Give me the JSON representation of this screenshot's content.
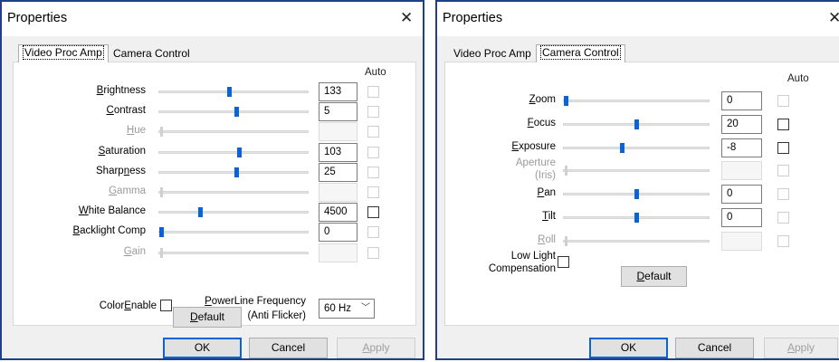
{
  "dialogs": [
    {
      "title": "Properties",
      "close_glyph": "✕",
      "tabs": [
        "Video Proc Amp",
        "Camera Control"
      ],
      "active_tab": 0,
      "auto_header": "Auto",
      "controls": [
        {
          "label": "Brightness",
          "value": "133",
          "slider": 0.45,
          "enabled": true,
          "auto_checked": false
        },
        {
          "label": "Contrast",
          "value": "5",
          "slider": 0.5,
          "enabled": true,
          "auto_checked": false
        },
        {
          "label": "Hue",
          "value": "",
          "slider": 0.0,
          "enabled": false,
          "auto_checked": false
        },
        {
          "label": "Saturation",
          "value": "103",
          "slider": 0.52,
          "enabled": true,
          "auto_checked": false
        },
        {
          "label": "Sharpness",
          "value": "25",
          "slider": 0.5,
          "enabled": true,
          "auto_checked": false
        },
        {
          "label": "Gamma",
          "value": "",
          "slider": 0.0,
          "enabled": false,
          "auto_checked": false
        },
        {
          "label": "White Balance",
          "value": "4500",
          "slider": 0.26,
          "enabled": true,
          "auto_checked": false
        },
        {
          "label": "Backlight Comp",
          "value": "0",
          "slider": 0.0,
          "enabled": true,
          "auto_checked": false
        },
        {
          "label": "Gain",
          "value": "",
          "slider": 0.0,
          "enabled": false,
          "auto_checked": false
        }
      ],
      "color_enable_label": "ColorEnable",
      "powerline_label_1": "PowerLine Frequency",
      "powerline_label_2": "(Anti Flicker)",
      "powerline_value": "60 Hz",
      "default_button": "Default",
      "ok_button": "OK",
      "cancel_button": "Cancel",
      "apply_button": "Apply"
    },
    {
      "title": "Properties",
      "close_glyph": "✕",
      "tabs": [
        "Video Proc Amp",
        "Camera Control"
      ],
      "active_tab": 1,
      "auto_header": "Auto",
      "controls": [
        {
          "label": "Zoom",
          "value": "0",
          "slider": 0.0,
          "enabled": true,
          "auto_checked": false
        },
        {
          "label": "Focus",
          "value": "20",
          "slider": 0.48,
          "enabled": true,
          "auto_checked": false
        },
        {
          "label": "Exposure",
          "value": "-8",
          "slider": 0.38,
          "enabled": true,
          "auto_checked": false
        },
        {
          "label": "Aperture",
          "label2": "(Iris)",
          "value": "",
          "slider": 0.0,
          "enabled": false,
          "auto_checked": false
        },
        {
          "label": "Pan",
          "value": "0",
          "slider": 0.48,
          "enabled": true,
          "auto_checked": false
        },
        {
          "label": "Tilt",
          "value": "0",
          "slider": 0.48,
          "enabled": true,
          "auto_checked": false
        },
        {
          "label": "Roll",
          "value": "",
          "slider": 0.0,
          "enabled": false,
          "auto_checked": false
        }
      ],
      "low_light_label_1": "Low Light",
      "low_light_label_2": "Compensation",
      "default_button": "Default",
      "ok_button": "OK",
      "cancel_button": "Cancel",
      "apply_button": "Apply"
    }
  ]
}
